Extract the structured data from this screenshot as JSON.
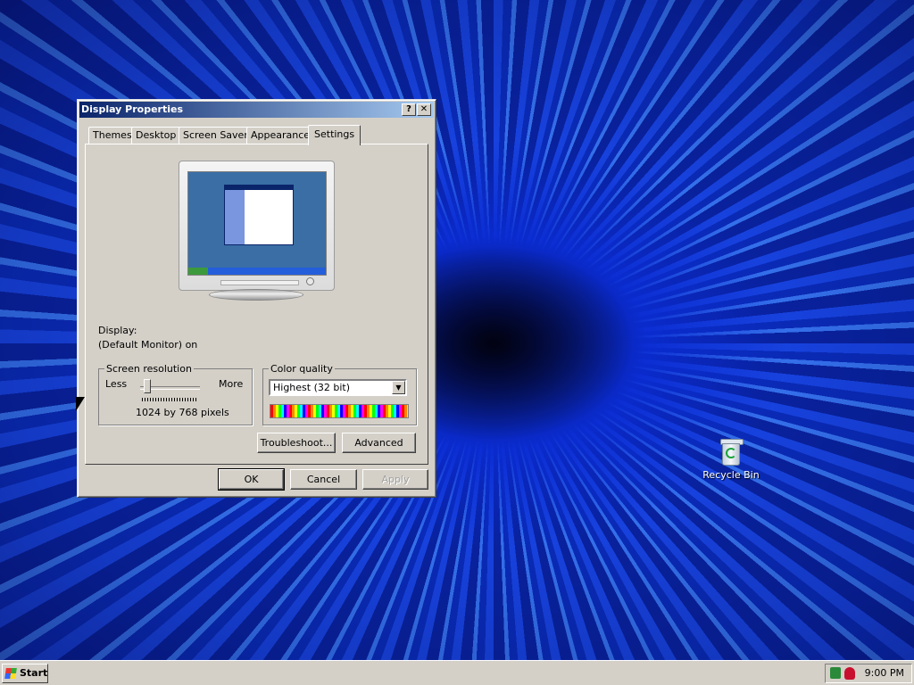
{
  "desktop": {
    "recycle_bin_label": "Recycle Bin"
  },
  "dialog": {
    "title": "Display Properties",
    "help_glyph": "?",
    "close_glyph": "✕",
    "tabs": [
      {
        "label": "Themes"
      },
      {
        "label": "Desktop"
      },
      {
        "label": "Screen Saver"
      },
      {
        "label": "Appearance"
      },
      {
        "label": "Settings"
      }
    ],
    "active_tab": "Settings",
    "display_label": "Display:",
    "display_value": "(Default Monitor) on",
    "resolution": {
      "group_label": "Screen resolution",
      "less_label": "Less",
      "more_label": "More",
      "value_text": "1024 by 768 pixels"
    },
    "color_quality": {
      "group_label": "Color quality",
      "selected": "Highest (32 bit)"
    },
    "buttons": {
      "troubleshoot": "Troubleshoot...",
      "advanced": "Advanced",
      "ok": "OK",
      "cancel": "Cancel",
      "apply": "Apply"
    }
  },
  "taskbar": {
    "start_label": "Start",
    "clock": "9:00 PM"
  },
  "colors": {
    "title_active_start": "#0a246a",
    "title_active_end": "#a6caf0",
    "dialog_face": "#d4d0c8",
    "desktop_blue": "#0b2dc0"
  }
}
